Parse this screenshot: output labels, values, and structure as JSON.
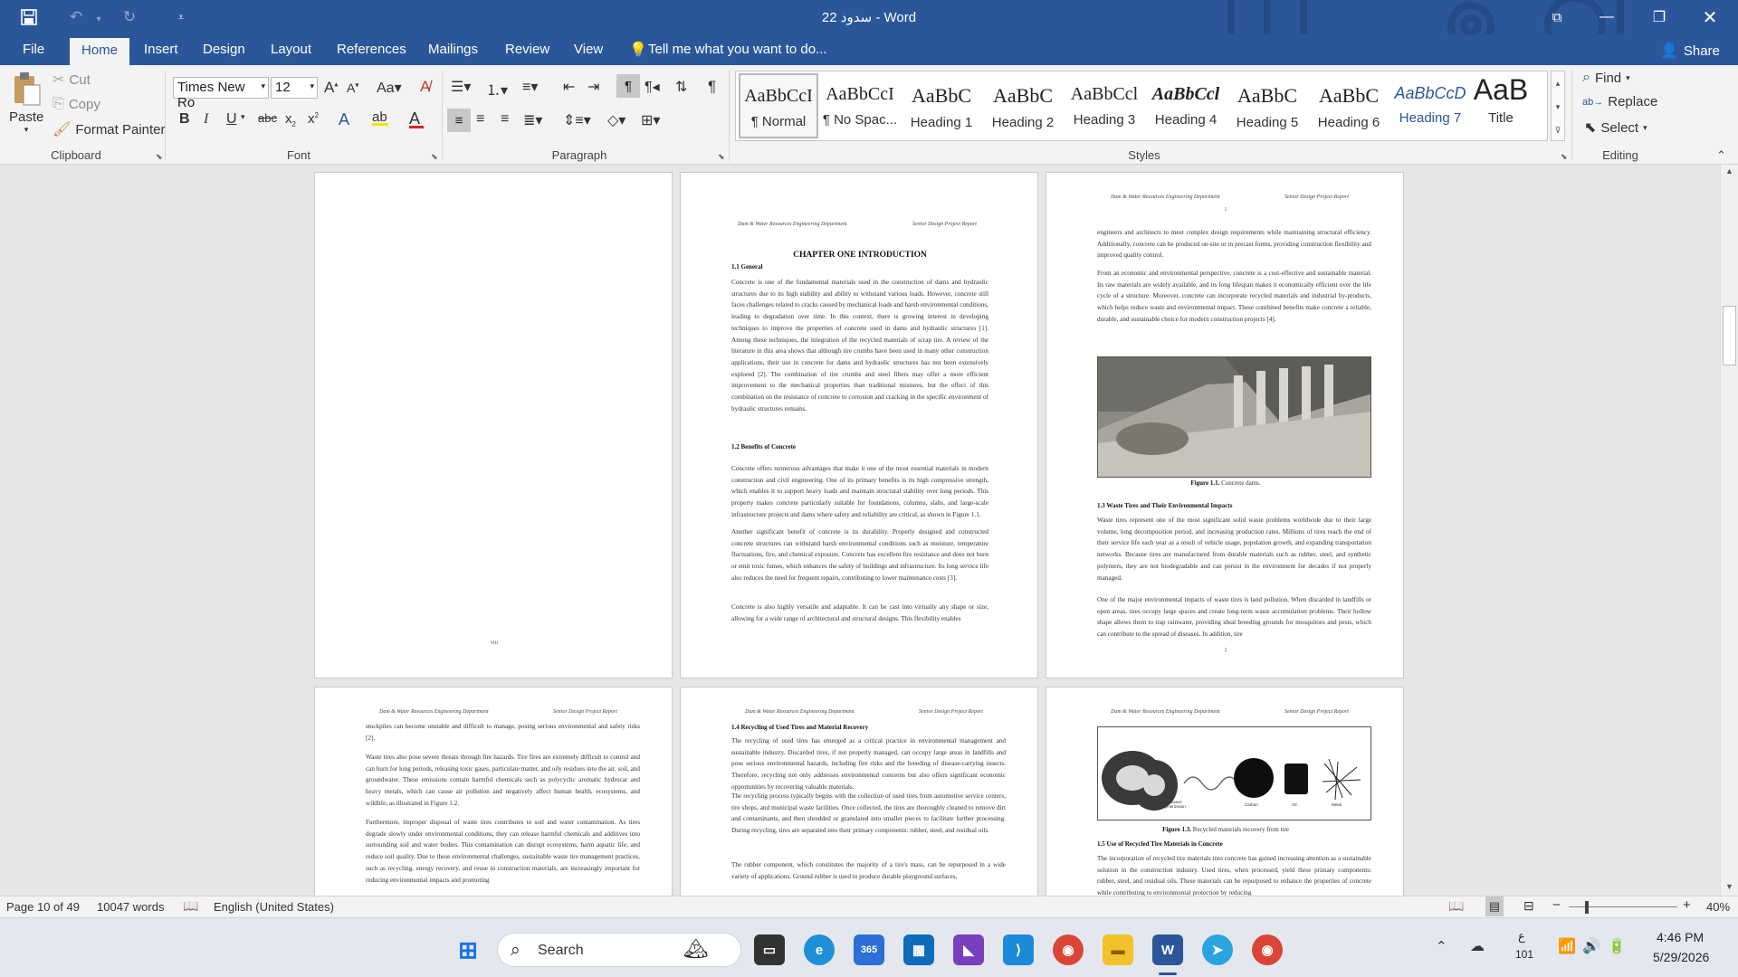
{
  "window": {
    "title": "سدود 22  -  Word",
    "colors": {
      "accent": "#2b579a"
    }
  },
  "qat": {
    "save_icon": "save-icon",
    "undo_icon": "undo-icon",
    "redo_icon": "redo-icon",
    "customize_icon": "customize-icon"
  },
  "window_controls": {
    "restore_ribbon": "ribbon-display-icon",
    "minimize": "minimize-icon",
    "maximize": "maximize-icon",
    "close": "close-icon"
  },
  "menu": {
    "tabs": [
      "File",
      "Home",
      "Insert",
      "Design",
      "Layout",
      "References",
      "Mailings",
      "Review",
      "View"
    ],
    "tellme": "Tell me what you want to do...",
    "share": "Share"
  },
  "clipboard": {
    "paste": "Paste",
    "cut": "Cut",
    "copy": "Copy",
    "format_painter": "Format Painter",
    "label": "Clipboard"
  },
  "font": {
    "name": "Times New Ro",
    "size": "12",
    "label": "Font"
  },
  "paragraph": {
    "label": "Paragraph"
  },
  "styles": {
    "label": "Styles",
    "items": [
      {
        "sample": "AaBbCcI",
        "name": "¶ Normal"
      },
      {
        "sample": "AaBbCcI",
        "name": "¶ No Spac..."
      },
      {
        "sample": "AaBbC",
        "name": "Heading 1"
      },
      {
        "sample": "AaBbC",
        "name": "Heading 2"
      },
      {
        "sample": "AaBbCcl",
        "name": "Heading 3"
      },
      {
        "sample": "AaBbCcl",
        "name": "Heading 4"
      },
      {
        "sample": "AaBbC",
        "name": "Heading 5"
      },
      {
        "sample": "AaBbC",
        "name": "Heading 6"
      },
      {
        "sample": "AaBbCcD",
        "name": "Heading 7"
      },
      {
        "sample": "AaB",
        "name": "Title"
      }
    ]
  },
  "editing": {
    "find": "Find",
    "replace": "Replace",
    "select": "Select",
    "label": "Editing"
  },
  "pages": {
    "p1": {
      "footer": "viii"
    },
    "p2": {
      "header_left": "Dam & Water Resources Engineering Department",
      "header_right": "Senior Design Project Report",
      "chapter": "CHAPTER ONE INTRODUCTION",
      "h_general": "1.1 General",
      "t_general": "Concrete is one of the fundamental materials used in the construction of dams and hydraulic structures due to its high stability and ability to withstand various loads. However, concrete still faces challenges related to cracks caused by mechanical loads and harsh environmental conditions, leading to degradation over time. In this context, there is growing interest in developing techniques to improve the properties of concrete used in dams and hydraulic structures [1]. Among these techniques, the integration of the recycled materials of scrap tire. A review of the literature in this area shows that although tire crumbs have been used in many other construction applications, their use in concrete for dams and hydraulic structures has not been extensively explored [2]. The combination of tire crumbs and steel fibers may offer a more efficient improvement to the mechanical properties than traditional mixtures, but the effect of this combination on the resistance of concrete to corrosion and cracking in the specific environment of hydraulic structures remains.",
      "h_benefits": "1.2 Benefits of Concrete",
      "t_benefits1": "Concrete offers numerous advantages that make it one of the most essential materials in modern construction and civil engineering. One of its primary benefits is its high compressive strength, which enables it to support heavy loads and maintain structural stability over long periods. This property makes concrete particularly suitable for foundations, columns, slabs, and large-scale infrastructure projects and dams where safety and reliability are critical, as shown in Figure 1.1.",
      "t_benefits2": "Another significant benefit of concrete is its durability. Properly designed and constructed concrete structures can withstand harsh environmental conditions such as moisture, temperature fluctuations, fire, and chemical exposure. Concrete has excellent fire resistance and does not burn or emit toxic fumes, which enhances the safety of buildings and infrastructure. Its long service life also reduces the need for frequent repairs, contributing to lower maintenance costs [3].",
      "t_benefits3": "Concrete is also highly versatile and adaptable. It can be cast into virtually any shape or size, allowing for a wide range of architectural and structural designs. This flexibility enables"
    },
    "p3": {
      "header_left": "Dam & Water Resources Engineering Department",
      "header_right": "Senior Design Project Report",
      "header_num": "1",
      "t1": "engineers and architects to meet complex design requirements while maintaining structural efficiency. Additionally, concrete can be produced on-site or in precast forms, providing construction flexibility and improved quality control.",
      "t2": "From an economic and environmental perspective, concrete is a cost-effective and sustainable material. Its raw materials are widely available, and its long lifespan makes it economically efficient over the life cycle of a structure. Moreover, concrete can incorporate recycled materials and industrial by-products, which helps reduce waste and environmental impact. These combined benefits make concrete a reliable, durable, and sustainable choice for modern construction projects [4].",
      "fig_label": "Figure 1.1.",
      "fig_text": "Concrete dams.",
      "h_waste": "1.3 Waste Tires and Their Environmental Impacts",
      "t_waste1": "Waste tires represent one of the most significant solid waste problems worldwide due to their large volume, long decomposition period, and increasing production rates. Millions of tires reach the end of their service life each year as a result of vehicle usage, population growth, and expanding transportation networks. Because tires are manufactured from durable materials such as rubber, steel, and synthetic polymers, they are not biodegradable and can persist in the environment for decades if not properly managed.",
      "t_waste2": "One of the major environmental impacts of waste tires is land pollution. When discarded in landfills or open areas, tires occupy large spaces and create long-term waste accumulation problems. Their hollow shape allows them to trap rainwater, providing ideal breeding grounds for mosquitoes and pests, which can contribute to the spread of diseases. In addition, tire",
      "footer": "2"
    },
    "p4": {
      "header_left": "Dam & Water Resources Engineering Department",
      "header_right": "Senior Design Project Report",
      "t1": "stockpiles can become unstable and difficult to manage, posing serious environmental and safety risks [2].",
      "t2": "Waste tires also pose severe threats through fire hazards. Tire fires are extremely difficult to control and can burn for long periods, releasing toxic gases, particulate matter, and oily residues into the air, soil, and groundwater. These emissions contain harmful chemicals such as polycyclic aromatic hydrocar and heavy metals, which can cause air pollution and negatively affect human health, ecosystems, and wildlife, as illustrated in Figure 1.2.",
      "t3": "Furthermore, improper disposal of waste tires contributes to soil and water contamination. As tires degrade slowly under environmental conditions, they can release harmful chemicals and additives into surrounding soil and water bodies. This contamination can disrupt ecosystems, harm aquatic life, and reduce soil quality. Due to these environmental challenges, sustainable waste tire management practices, such as recycling, energy recovery, and reuse in construction materials, are increasingly important for reducing environmental impacts and promoting"
    },
    "p5": {
      "header_left": "Dam & Water Resources Engineering Department",
      "header_right": "Senior Design Project Report",
      "h1": "1.4 Recycling of Used Tires and Material Recovery",
      "t1": "The recycling of used tires has emerged as a critical practice in environmental management and sustainable industry. Discarded tires, if not properly managed, can occupy large areas in landfills and pose serious environmental hazards, including fire risks and the breeding of disease-carrying insects. Therefore, recycling not only addresses environmental concerns but also offers significant economic opportunities by recovering valuable materials.",
      "t2": "The recycling process typically begins with the collection of used tires from automotive service centers, tire shops, and municipal waste facilities. Once collected, the tires are thoroughly cleaned to remove dirt and contaminants, and then shredded or granulated into smaller pieces to facilitate further processing. During recycling, tires are separated into their primary components: rubber, steel, and residual oils.",
      "t3": "The rubber component, which constitutes the majority of a tire's mass, can be repurposed in a wide variety of applications. Ground rubber is used to produce durable playground surfaces,"
    },
    "p6": {
      "header_left": "Dam & Water Resources Engineering Department",
      "header_right": "Senior Design Project Report",
      "fig_items": [
        "Microwave Polymerization",
        "Carbon",
        "Oil",
        "Metal"
      ],
      "fig_label": "Figure 1.3.",
      "fig_text": "Recycled materials recovery from tire",
      "h1": "1.5 Use of Recycled Tire Materials in Concrete",
      "t1": "The incorporation of recycled tire materials into concrete has gained increasing attention as a sustainable solution in the construction industry. Used tires, when processed, yield three primary components: rubber, steel, and residual oils. These materials can be repurposed to enhance the properties of concrete while contributing to environmental protection by reducing"
    }
  },
  "status": {
    "page": "Page 10 of 49",
    "words": "10047 words",
    "language": "English (United States)",
    "zoom": "40%",
    "zoom_level": 0.4
  },
  "taskbar": {
    "search": "Search",
    "lang_top": "ع",
    "lang_bottom": "101",
    "time": "4:46 PM",
    "date": "5/29/2026"
  }
}
